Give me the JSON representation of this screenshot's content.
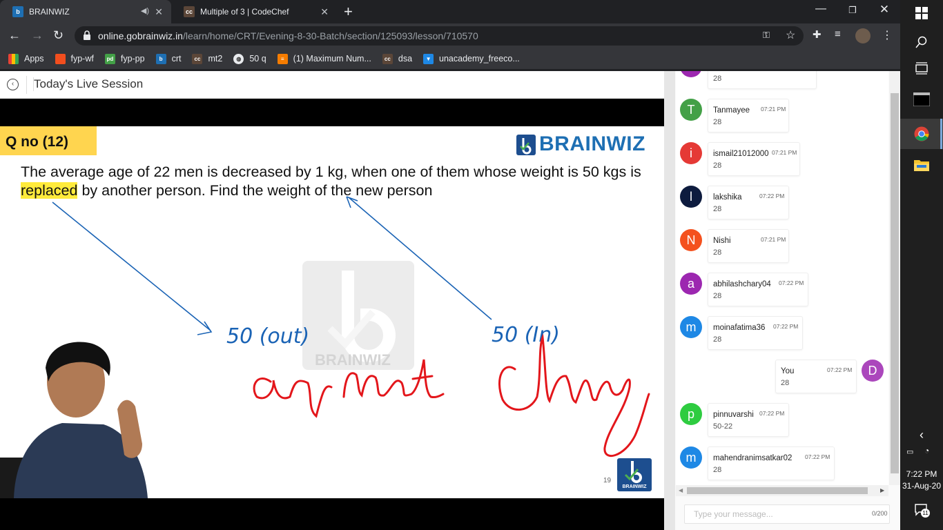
{
  "browser": {
    "tabs": [
      {
        "title": "BRAINWIZ",
        "favicon": "brainwiz-favicon"
      },
      {
        "title": "Multiple of 3 | CodeChef",
        "favicon": "codechef-favicon"
      }
    ],
    "url_host": "online.gobrainwiz.in",
    "url_path": "/learn/home/CRT/Evening-8-30-Batch/section/125093/lesson/710570",
    "bookmarks": [
      "Apps",
      "fyp-wf",
      "fyp-pp",
      "crt",
      "mt2",
      "50 q",
      "(1) Maximum Num...",
      "dsa",
      "unacademy_freeco..."
    ]
  },
  "session": {
    "title": "Today's Live Session"
  },
  "slide": {
    "qno": "Q no (12)",
    "question_a": "The average age of 22 men is decreased by 1 kg, when one of them whose weight is 50 kgs is ",
    "question_hl": "replaced",
    "question_b": " by another person. Find the weight of the new person",
    "brand": "BRAINWIZ",
    "watermark": "BRAINWIZ",
    "page_number": "19",
    "badge_text": "BRAINWIZ",
    "ann_out": "50 (out)",
    "ann_in": "50 (In)"
  },
  "chat": {
    "messages": [
      {
        "name": "",
        "time": "",
        "text": "28",
        "initial": "",
        "color": "#9c27b0"
      },
      {
        "name": "Tanmayee",
        "time": "07:21 PM",
        "text": "28",
        "initial": "T",
        "color": "#43a047"
      },
      {
        "name": "ismail21012000",
        "time": "07:21 PM",
        "text": "28",
        "initial": "i",
        "color": "#e53935"
      },
      {
        "name": "lakshika",
        "time": "07:22 PM",
        "text": "28",
        "initial": "l",
        "color": "#0d1b3e"
      },
      {
        "name": "Nishi",
        "time": "07:21 PM",
        "text": "28",
        "initial": "N",
        "color": "#f4511e"
      },
      {
        "name": "abhilashchary04",
        "time": "07:22 PM",
        "text": "28",
        "initial": "a",
        "color": "#9c27b0"
      },
      {
        "name": "moinafatima36",
        "time": "07:22 PM",
        "text": "28",
        "initial": "m",
        "color": "#1e88e5"
      },
      {
        "name": "You",
        "time": "07:22 PM",
        "text": "28",
        "initial": "D",
        "color": "#ab47bc"
      },
      {
        "name": "pinnuvarshi",
        "time": "07:22 PM",
        "text": "50-22",
        "initial": "p",
        "color": "#2ecc40"
      },
      {
        "name": "mahendranimsatkar02",
        "time": "07:22 PM",
        "text": "28",
        "initial": "m",
        "color": "#1e88e5"
      }
    ],
    "input_placeholder": "Type your message...",
    "char_count": "0/200"
  },
  "taskbar": {
    "time": "7:22 PM",
    "date": "31-Aug-20",
    "notifications": "11"
  }
}
